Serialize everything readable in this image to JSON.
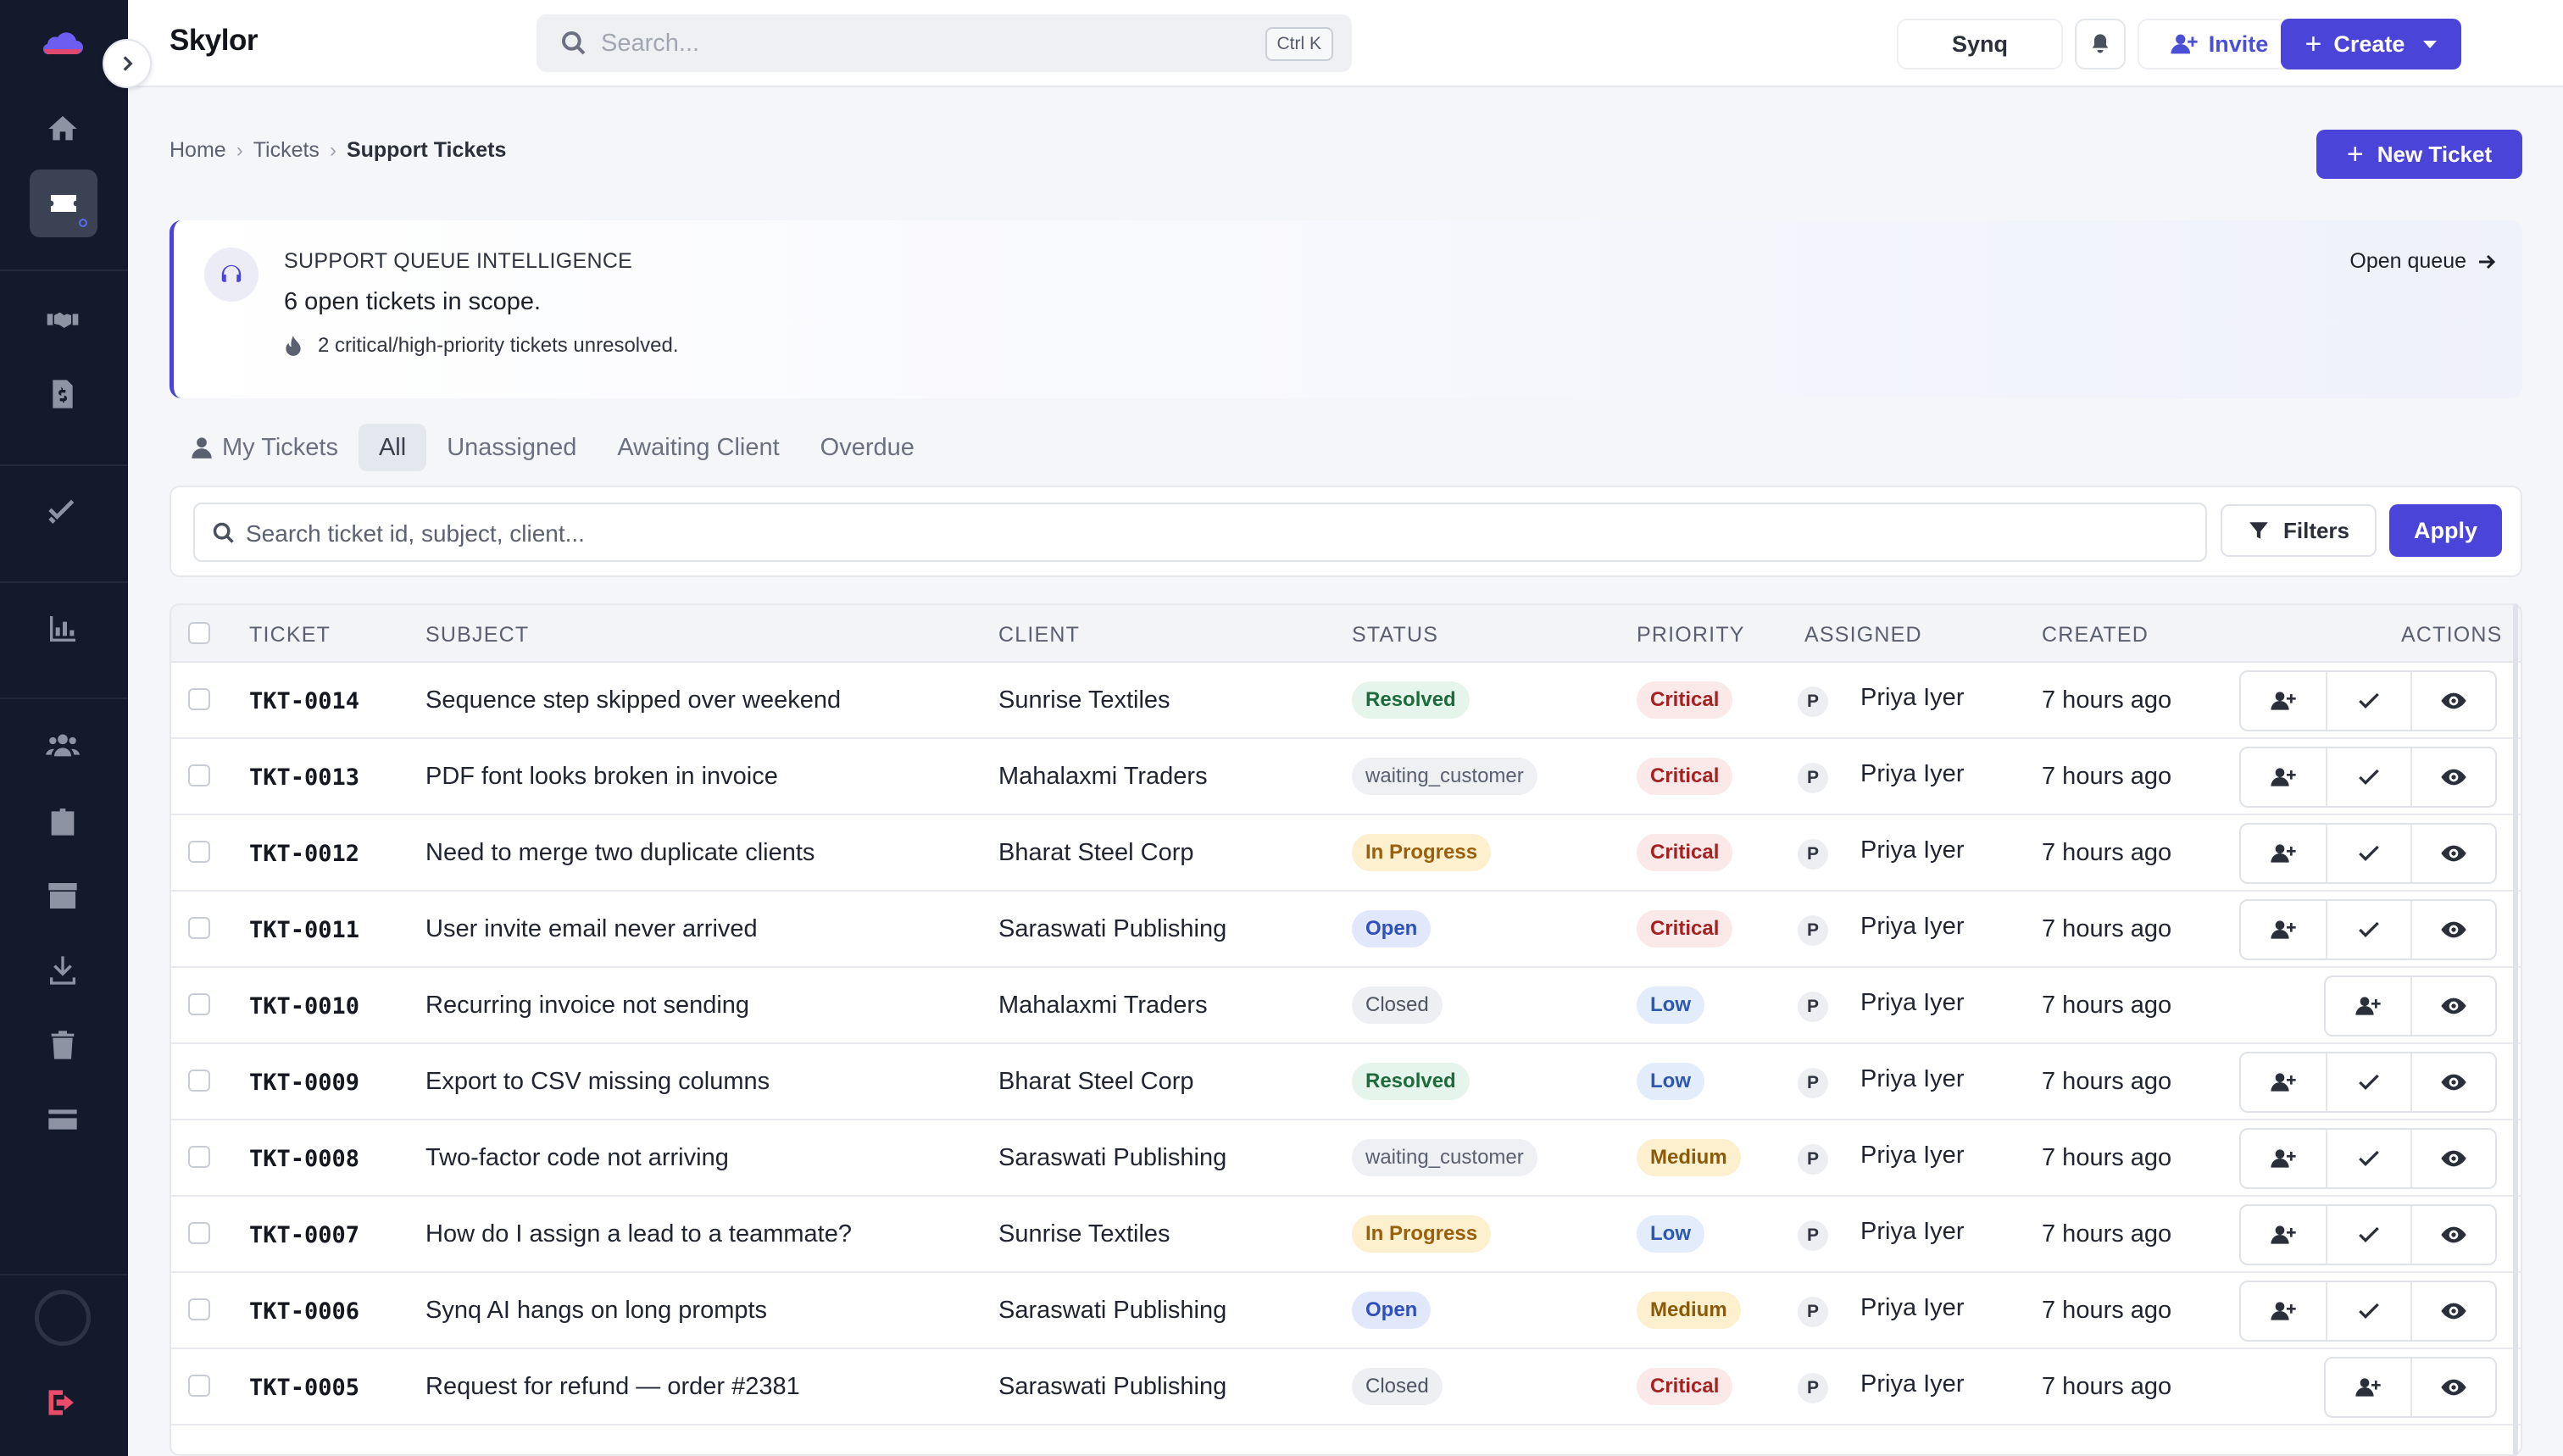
{
  "app": {
    "brand": "Skylor",
    "search_placeholder": "Search...",
    "search_shortcut": "Ctrl K",
    "synq_label": "Synq",
    "invite_label": "Invite",
    "create_label": "Create"
  },
  "sidebar": {
    "items": [
      {
        "name": "home-icon"
      },
      {
        "name": "tickets-icon",
        "active": true
      },
      {
        "name": "handshake-icon"
      },
      {
        "name": "invoice-icon"
      },
      {
        "name": "tasks-check-icon"
      },
      {
        "name": "reports-chart-icon"
      },
      {
        "name": "team-icon"
      },
      {
        "name": "contacts-badge-icon"
      },
      {
        "name": "archive-box-icon"
      },
      {
        "name": "download-icon"
      },
      {
        "name": "trash-icon"
      },
      {
        "name": "billing-card-icon"
      }
    ]
  },
  "breadcrumb": {
    "items": [
      "Home",
      "Tickets"
    ],
    "current": "Support Tickets"
  },
  "new_ticket_label": "New Ticket",
  "banner": {
    "eyebrow": "SUPPORT QUEUE INTELLIGENCE",
    "headline": "6 open tickets in scope.",
    "alert": "2 critical/high-priority tickets unresolved.",
    "open_queue": "Open queue"
  },
  "tabs": [
    {
      "label": "My Tickets",
      "active": false
    },
    {
      "label": "All",
      "active": true
    },
    {
      "label": "Unassigned",
      "active": false
    },
    {
      "label": "Awaiting Client",
      "active": false
    },
    {
      "label": "Overdue",
      "active": false
    }
  ],
  "filters": {
    "search_placeholder": "Search ticket id, subject, client...",
    "filters_label": "Filters",
    "apply_label": "Apply"
  },
  "table": {
    "columns": [
      "TICKET",
      "SUBJECT",
      "CLIENT",
      "STATUS",
      "PRIORITY",
      "ASSIGNED",
      "CREATED",
      "ACTIONS"
    ],
    "rows": [
      {
        "id": "TKT-0014",
        "subject": "Sequence step skipped over weekend",
        "client": "Sunrise Textiles",
        "status": "Resolved",
        "status_style": "resolved",
        "priority": "Critical",
        "priority_style": "critical",
        "initial": "P",
        "assignee": "Priya Iyer",
        "created": "7 hours ago",
        "can_resolve": true
      },
      {
        "id": "TKT-0013",
        "subject": "PDF font looks broken in invoice",
        "client": "Mahalaxmi Traders",
        "status": "waiting_customer",
        "status_style": "waiting",
        "priority": "Critical",
        "priority_style": "critical",
        "initial": "P",
        "assignee": "Priya Iyer",
        "created": "7 hours ago",
        "can_resolve": true
      },
      {
        "id": "TKT-0012",
        "subject": "Need to merge two duplicate clients",
        "client": "Bharat Steel Corp",
        "status": "In Progress",
        "status_style": "progress",
        "priority": "Critical",
        "priority_style": "critical",
        "initial": "P",
        "assignee": "Priya Iyer",
        "created": "7 hours ago",
        "can_resolve": true
      },
      {
        "id": "TKT-0011",
        "subject": "User invite email never arrived",
        "client": "Saraswati Publishing",
        "status": "Open",
        "status_style": "open",
        "priority": "Critical",
        "priority_style": "critical",
        "initial": "P",
        "assignee": "Priya Iyer",
        "created": "7 hours ago",
        "can_resolve": true
      },
      {
        "id": "TKT-0010",
        "subject": "Recurring invoice not sending",
        "client": "Mahalaxmi Traders",
        "status": "Closed",
        "status_style": "closed",
        "priority": "Low",
        "priority_style": "low",
        "initial": "P",
        "assignee": "Priya Iyer",
        "created": "7 hours ago",
        "can_resolve": false
      },
      {
        "id": "TKT-0009",
        "subject": "Export to CSV missing columns",
        "client": "Bharat Steel Corp",
        "status": "Resolved",
        "status_style": "resolved",
        "priority": "Low",
        "priority_style": "low",
        "initial": "P",
        "assignee": "Priya Iyer",
        "created": "7 hours ago",
        "can_resolve": true
      },
      {
        "id": "TKT-0008",
        "subject": "Two-factor code not arriving",
        "client": "Saraswati Publishing",
        "status": "waiting_customer",
        "status_style": "waiting",
        "priority": "Medium",
        "priority_style": "medium",
        "initial": "P",
        "assignee": "Priya Iyer",
        "created": "7 hours ago",
        "can_resolve": true
      },
      {
        "id": "TKT-0007",
        "subject": "How do I assign a lead to a teammate?",
        "client": "Sunrise Textiles",
        "status": "In Progress",
        "status_style": "progress",
        "priority": "Low",
        "priority_style": "low",
        "initial": "P",
        "assignee": "Priya Iyer",
        "created": "7 hours ago",
        "can_resolve": true
      },
      {
        "id": "TKT-0006",
        "subject": "Synq AI hangs on long prompts",
        "client": "Saraswati Publishing",
        "status": "Open",
        "status_style": "open",
        "priority": "Medium",
        "priority_style": "medium",
        "initial": "P",
        "assignee": "Priya Iyer",
        "created": "7 hours ago",
        "can_resolve": true
      },
      {
        "id": "TKT-0005",
        "subject": "Request for refund — order #2381",
        "client": "Saraswati Publishing",
        "status": "Closed",
        "status_style": "closed",
        "priority": "Critical",
        "priority_style": "critical",
        "initial": "P",
        "assignee": "Priya Iyer",
        "created": "7 hours ago",
        "can_resolve": false
      }
    ]
  },
  "colors": {
    "accent": "#4a44d8",
    "sidebar_bg": "#131a2b",
    "logout": "#ea4c6a"
  }
}
